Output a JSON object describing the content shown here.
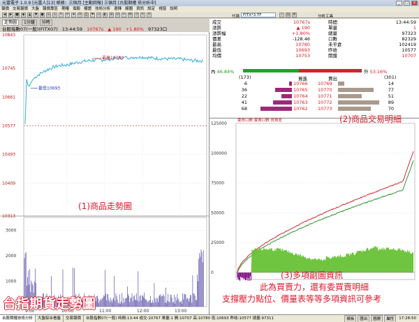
{
  "window": {
    "title": "元富電子 1.0.9 [元富人]13] 帳務：三個月 [主動回報] 三個月 [台股期權 依分析中]",
    "menu": [
      "報價",
      "交易報價",
      "大盤",
      "報價專區",
      "期權",
      "個股",
      "權證",
      "技術分析",
      "選擇",
      "線圖",
      "資訊",
      "設定",
      "視窗",
      "說明"
    ],
    "search_label": "代碼",
    "search_value": "FITX*3.TF",
    "analysis_label": "分析工具"
  },
  "chart_info": {
    "tab1": "走勢圖",
    "tab2": "1分鐘",
    "tab3": "分時",
    "symbol": "台股指數07(一般)(FITX07)",
    "time": "13:44:59",
    "price": "10767s",
    "change_arrow": "▲",
    "change": "190",
    "pct": "+1.80%",
    "volume": "97323口"
  },
  "main_chart": {
    "yticks": [
      "10843",
      "10745",
      "10661",
      "10577",
      "10493",
      "10409",
      "10313"
    ],
    "xticks": [
      "9:00",
      "10:00",
      "11:00",
      "12:00",
      "13:00"
    ],
    "vol_ticks": [
      "3000",
      "2000",
      "1000"
    ],
    "max_label": "最高10780",
    "min_label": "最低10693",
    "label1": "(1)商品走勢圖",
    "big_title": "台指期貨走勢圖"
  },
  "quote": {
    "left": [
      {
        "label": "成交",
        "value": "10767s",
        "color": "#e8141e"
      },
      {
        "label": "漲跌",
        "value": "▲ 190",
        "color": "#e8141e"
      },
      {
        "label": "漲跌幅",
        "value": "+1.80%",
        "color": "#e8141e"
      },
      {
        "label": "價差",
        "value": "-128.46",
        "color": "#000000"
      },
      {
        "label": "最高",
        "value": "10780",
        "color": "#e8141e"
      },
      {
        "label": "最低",
        "value": "10693",
        "color": "#e8141e"
      },
      {
        "label": "均價",
        "value": "10753",
        "color": "#e8141e"
      }
    ],
    "right": [
      {
        "label": "時間",
        "value": "13:44:59",
        "color": "#000000"
      },
      {
        "label": "單量",
        "value": "1",
        "color": "#e8141e"
      },
      {
        "label": "總量",
        "value": "97323",
        "color": "#000000"
      },
      {
        "label": "口數",
        "value": "82329",
        "color": "#000000"
      },
      {
        "label": "未平倉",
        "value": "102419",
        "color": "#000000"
      },
      {
        "label": "昨收",
        "value": "10577",
        "color": "#000000"
      },
      {
        "label": "開盤",
        "value": "10707",
        "color": "#e8141e"
      }
    ],
    "in_label": "內",
    "in_pct": "46.84%",
    "out_label": "外",
    "out_pct": "53.16%",
    "in_ratio": 0.4684,
    "bid_total": "(173)",
    "ask_total": "(301)",
    "bid_head": "買進",
    "ask_head": "賣出",
    "orderbook": [
      {
        "bq": "6",
        "bp": "10766",
        "ap": "10769",
        "aq": "14",
        "bqn": 6,
        "aqn": 14
      },
      {
        "bq": "36",
        "bp": "10765",
        "ap": "10770",
        "aq": "77",
        "bqn": 36,
        "aqn": 77
      },
      {
        "bq": "22",
        "bp": "10764",
        "ap": "10771",
        "aq": "51",
        "bqn": 22,
        "aqn": 51
      },
      {
        "bq": "41",
        "bp": "10763",
        "ap": "10772",
        "aq": "89",
        "bqn": 41,
        "aqn": 89
      },
      {
        "bq": "68",
        "bp": "10762",
        "ap": "10773",
        "aq": "70",
        "bqn": 68,
        "aqn": 70
      }
    ],
    "label2": "(2)商品交易明細"
  },
  "sub_chart": {
    "legend": "委買口數 委賣口數 買賣差",
    "yticks": [
      "125000",
      "100000",
      "75000",
      "50000",
      "25000",
      "0"
    ],
    "label3a": "(3)多項副圖資訊",
    "label3b": "此為買賣力，還有委買賣明細",
    "label3c": "支撐壓力點位、價量表等等多項資訊可參考"
  },
  "statusbar": {
    "tabs": [
      "台股期權技術分析",
      "大盤綜合看盤",
      "交易報價"
    ],
    "info": "台股指數07(一般) 時間:13:44 成交:10767 單量:1 開:10707 高:10780 低:10693 昨收:10577 總量:97311",
    "buttons": [
      "樣板",
      "匯出",
      "圖層",
      "屬性"
    ],
    "clock": "17:28:50"
  },
  "chart_data": {
    "type": "line",
    "title": "台股指數07(一般)(FITX07)",
    "ylim": [
      10313,
      10843
    ],
    "reference": 10577,
    "x": [
      "9:00",
      "10:00",
      "11:00",
      "12:00",
      "13:00",
      "13:45"
    ],
    "series": [
      {
        "values": [
          10693,
          10755,
          10770,
          10778,
          10772,
          10767
        ]
      }
    ],
    "high": 10780,
    "low": 10693,
    "volume_ylim": [
      0,
      3500
    ],
    "volume_peaks": [
      3100,
      1600,
      1000,
      900,
      700,
      600,
      500,
      2500,
      2000
    ]
  },
  "colors": {
    "price_line": "#22a7d6",
    "bid_line": "#c8141e",
    "ask_line": "#1a8a1a",
    "diff_area": "#5fbf2a",
    "neg_area": "#8a1a8a",
    "volume_bar": "#5a4fa8"
  }
}
